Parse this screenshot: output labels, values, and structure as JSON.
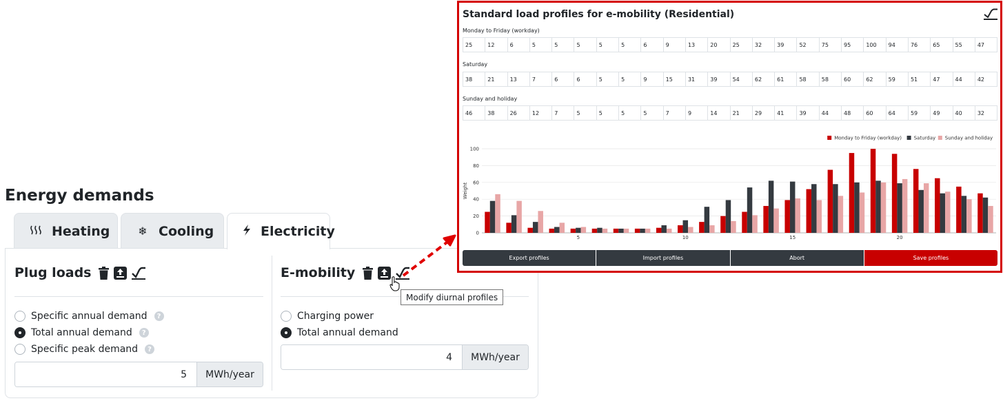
{
  "energy": {
    "title": "Energy demands",
    "tabs": [
      {
        "label": "Heating",
        "icon": "heat-waves-icon"
      },
      {
        "label": "Cooling",
        "icon": "snowflake-icon"
      },
      {
        "label": "Electricity",
        "icon": "lightning-icon",
        "active": true
      }
    ]
  },
  "plug_loads": {
    "title": "Plug loads",
    "options": [
      "Specific annual demand",
      "Total annual demand",
      "Specific peak demand"
    ],
    "selected": "Total annual demand",
    "value": "5",
    "unit": "MWh/year"
  },
  "emobility": {
    "title": "E-mobility",
    "options": [
      "Charging power",
      "Total annual demand"
    ],
    "selected": "Total annual demand",
    "value": "4",
    "unit": "MWh/year",
    "tooltip": "Modify diurnal profiles"
  },
  "modal": {
    "title": "Standard load profiles for e-mobility (Residential)",
    "rows": [
      {
        "label": "Monday to Friday (workday)",
        "values": [
          25,
          12,
          6,
          5,
          5,
          5,
          5,
          5,
          6,
          9,
          13,
          20,
          25,
          32,
          39,
          52,
          75,
          95,
          100,
          94,
          76,
          65,
          55,
          47
        ]
      },
      {
        "label": "Saturday",
        "values": [
          38,
          21,
          13,
          7,
          6,
          6,
          5,
          5,
          9,
          15,
          31,
          39,
          54,
          62,
          61,
          58,
          58,
          60,
          62,
          59,
          51,
          47,
          44,
          42
        ]
      },
      {
        "label": "Sunday and holiday",
        "values": [
          46,
          38,
          26,
          12,
          7,
          5,
          5,
          5,
          5,
          7,
          9,
          14,
          21,
          29,
          41,
          39,
          44,
          48,
          60,
          64,
          59,
          49,
          40,
          32
        ]
      }
    ],
    "buttons": {
      "export": "Export profiles",
      "import": "Import profiles",
      "abort": "Abort",
      "save": "Save profiles"
    }
  },
  "chart_data": {
    "type": "bar",
    "categories": [
      1,
      2,
      3,
      4,
      5,
      6,
      7,
      8,
      9,
      10,
      11,
      12,
      13,
      14,
      15,
      16,
      17,
      18,
      19,
      20,
      21,
      22,
      23,
      24
    ],
    "x_tick_labels": [
      "5",
      "10",
      "15",
      "20"
    ],
    "ylabel": "Weight",
    "ylim": [
      0,
      100
    ],
    "y_ticks": [
      0,
      20,
      40,
      60,
      80,
      100
    ],
    "legend_position": "top-right",
    "grid": true,
    "series": [
      {
        "name": "Monday to Friday (workday)",
        "color": "#c80000",
        "values": [
          25,
          12,
          6,
          5,
          5,
          5,
          5,
          5,
          6,
          9,
          13,
          20,
          25,
          32,
          39,
          52,
          75,
          95,
          100,
          94,
          76,
          65,
          55,
          47
        ]
      },
      {
        "name": "Saturday",
        "color": "#343a40",
        "values": [
          38,
          21,
          13,
          7,
          6,
          6,
          5,
          5,
          9,
          15,
          31,
          39,
          54,
          62,
          61,
          58,
          58,
          60,
          62,
          59,
          51,
          47,
          44,
          42
        ]
      },
      {
        "name": "Sunday and holiday",
        "color": "#e8a6a6",
        "values": [
          46,
          38,
          26,
          12,
          7,
          5,
          5,
          5,
          5,
          7,
          9,
          14,
          21,
          29,
          41,
          39,
          44,
          48,
          60,
          64,
          59,
          49,
          40,
          32
        ]
      }
    ]
  }
}
